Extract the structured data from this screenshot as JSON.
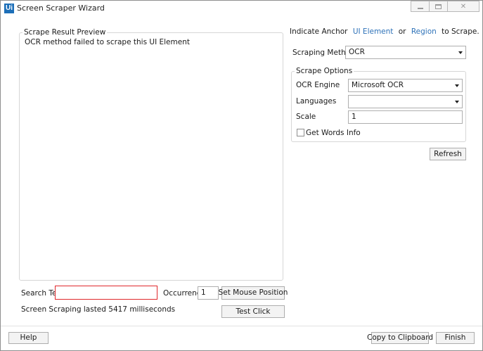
{
  "window": {
    "app_icon_text": "Ui",
    "title": "Screen Scraper Wizard",
    "controls": [
      "minimize-icon",
      "maximize-icon",
      "close-icon"
    ],
    "close_glyph": "✕"
  },
  "preview": {
    "caption": "Scrape Result Preview",
    "result_text": "OCR method failed to scrape this UI Element"
  },
  "search": {
    "label": "Search Text",
    "value": ""
  },
  "occurrence": {
    "label": "Occurrence",
    "value": "1"
  },
  "buttons": {
    "set_mouse_position": "Set Mouse Position",
    "test_click": "Test Click",
    "refresh": "Refresh",
    "help": "Help",
    "copy_to_clipboard": "Copy to Clipboard",
    "finish": "Finish"
  },
  "status_text": "Screen Scraping lasted 5417 milliseconds",
  "anchor": {
    "prefix": "Indicate Anchor",
    "ui_element_link": "UI Element",
    "or": "or",
    "region_link": "Region",
    "suffix": "to Scrape."
  },
  "scraping_method": {
    "label": "Scraping Method",
    "value": "OCR"
  },
  "scrape_options": {
    "caption": "Scrape Options",
    "ocr_engine_label": "OCR Engine",
    "ocr_engine_value": "Microsoft OCR",
    "languages_label": "Languages",
    "languages_value": "",
    "scale_label": "Scale",
    "scale_value": "1",
    "get_words_info_label": "Get Words Info",
    "get_words_info_checked": false
  },
  "colors": {
    "accent_link": "#2e72b8",
    "error_border": "#e0282b",
    "app_icon_bg": "#1d6fb8"
  }
}
